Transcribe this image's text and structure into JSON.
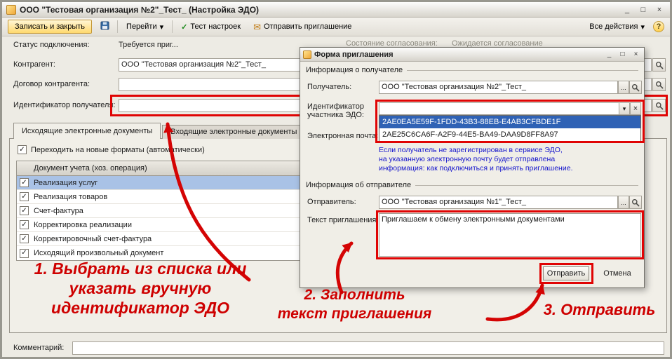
{
  "icons": {
    "check": "✓",
    "dropdown_small": "▾",
    "combo_arrow": "▼",
    "close": "×",
    "minimize": "_",
    "maximize": "□",
    "ellipsis": "...",
    "envelope": "✉",
    "help": "?"
  },
  "window": {
    "title": "ООО \"Тестовая организация №2\"_Тест_ (Настройка ЭДО)"
  },
  "toolbar": {
    "save_close": "Записать и закрыть",
    "goto": "Перейти",
    "test": "Тест настроек",
    "send_invite": "Отправить приглашение",
    "all_actions": "Все действия"
  },
  "form": {
    "status_label": "Статус подключения:",
    "status_value": "Требуется приг...",
    "counterparty_label": "Контрагент:",
    "counterparty_value": "ООО \"Тестовая организация №2\"_Тест_",
    "contract_label": "Договор контрагента:",
    "contract_value": "",
    "recipient_id_label": "Идентификатор получателя:",
    "recipient_id_value": "",
    "agreement_state_label": "Состояние согласования:",
    "agreement_state_value": "Ожидается согласование",
    "comment_label": "Комментарий:",
    "comment_value": ""
  },
  "tabs": [
    {
      "label": "Исходящие электронные документы"
    },
    {
      "label": "Входящие электронные документы"
    }
  ],
  "tab_panel": {
    "new_formats_checkbox": "Переходить на новые форматы (автоматически)",
    "table": {
      "header": "Документ учета (хоз. операция)",
      "rows": [
        {
          "label": "Реализация услуг"
        },
        {
          "label": "Реализация товаров"
        },
        {
          "label": "Счет-фактура"
        },
        {
          "label": "Корректировка реализации"
        },
        {
          "label": "Корректировочный счет-фактура"
        },
        {
          "label": "Исходящий произвольный документ"
        }
      ]
    }
  },
  "dialog": {
    "title": "Форма приглашения",
    "recipient_group": "Информация о получателе",
    "recipient_label": "Получатель:",
    "recipient_value": "ООО \"Тестовая организация №2\"_Тест_",
    "edo_id_label_line1": "Идентификатор",
    "edo_id_label_line2": "участника ЭДО:",
    "edo_id_value": "",
    "dropdown_items": [
      "2AE0EA5E59F-1FDD-43B3-88EB-E4AB3CFBDE1F",
      "2AE25C6CA6F-A2F9-44E5-BA49-DAA9D8FF8A97"
    ],
    "email_label": "Электронная почта:",
    "hint_lines": [
      "Если получатель не зарегистрирован в сервисе ЭДО,",
      "на указанную электронную почту будет отправлена",
      "информация: как подключиться и принять приглашение."
    ],
    "sender_group": "Информация об отправителе",
    "sender_label": "Отправитель:",
    "sender_value": "ООО \"Тестовая организация №1\"_Тест_",
    "invite_text_label": "Текст приглашения:",
    "invite_text_value": "Приглашаем к обмену электронными документами",
    "send_button": "Отправить",
    "cancel_button": "Отмена"
  },
  "annotations": {
    "step1_lines": [
      "1. Выбрать из списка или",
      "указать вручную",
      "идентификатор ЭДО"
    ],
    "step2_lines": [
      "2. Заполнить",
      "текст приглашения"
    ],
    "step3": "3. Отправить"
  }
}
